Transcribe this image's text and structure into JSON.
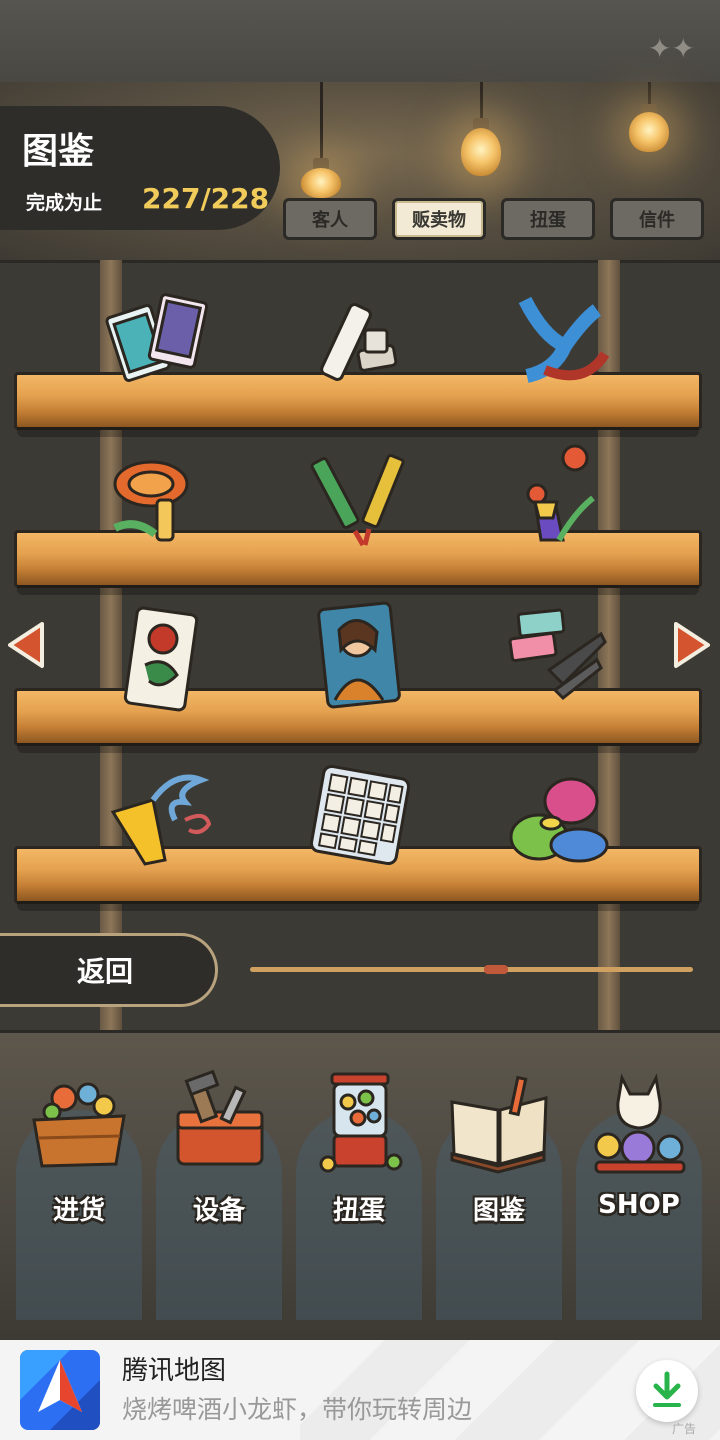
{
  "header": {
    "title": "图鉴",
    "progress_label": "完成为止",
    "progress_value": "227/228"
  },
  "tabs": [
    {
      "label": "客人",
      "active": false
    },
    {
      "label": "贩卖物",
      "active": true
    },
    {
      "label": "扭蛋",
      "active": false
    },
    {
      "label": "信件",
      "active": false
    }
  ],
  "shelves": [
    {
      "items": [
        "trading-cards-icon",
        "chalk-icon",
        "slingshot-icon"
      ]
    },
    {
      "items": [
        "bamboo-copter-icon",
        "sparkler-fireworks-icon",
        "cup-and-ball-icon"
      ]
    },
    {
      "items": [
        "hanafuda-card-icon",
        "portrait-card-icon",
        "ticket-punch-icon"
      ]
    },
    {
      "items": [
        "paper-streamer-icon",
        "sliding-number-puzzle-icon",
        "jelly-balls-icon"
      ]
    }
  ],
  "back_label": "返回",
  "bottom_nav": [
    {
      "label": "进货",
      "icon": "stock-crate-icon"
    },
    {
      "label": "设备",
      "icon": "toolbox-icon"
    },
    {
      "label": "扭蛋",
      "icon": "gacha-machine-icon"
    },
    {
      "label": "图鉴",
      "icon": "open-book-icon"
    },
    {
      "label": "SHOP",
      "icon": "lucky-cat-icon"
    }
  ],
  "ad": {
    "title": "腾讯地图",
    "description": "烧烤啤酒小龙虾，带你玩转周边",
    "tag": "广告"
  },
  "colors": {
    "accent_gold": "#f2cc5a",
    "arrow_red": "#d4542f",
    "shelf_wood": "#e4a150"
  }
}
